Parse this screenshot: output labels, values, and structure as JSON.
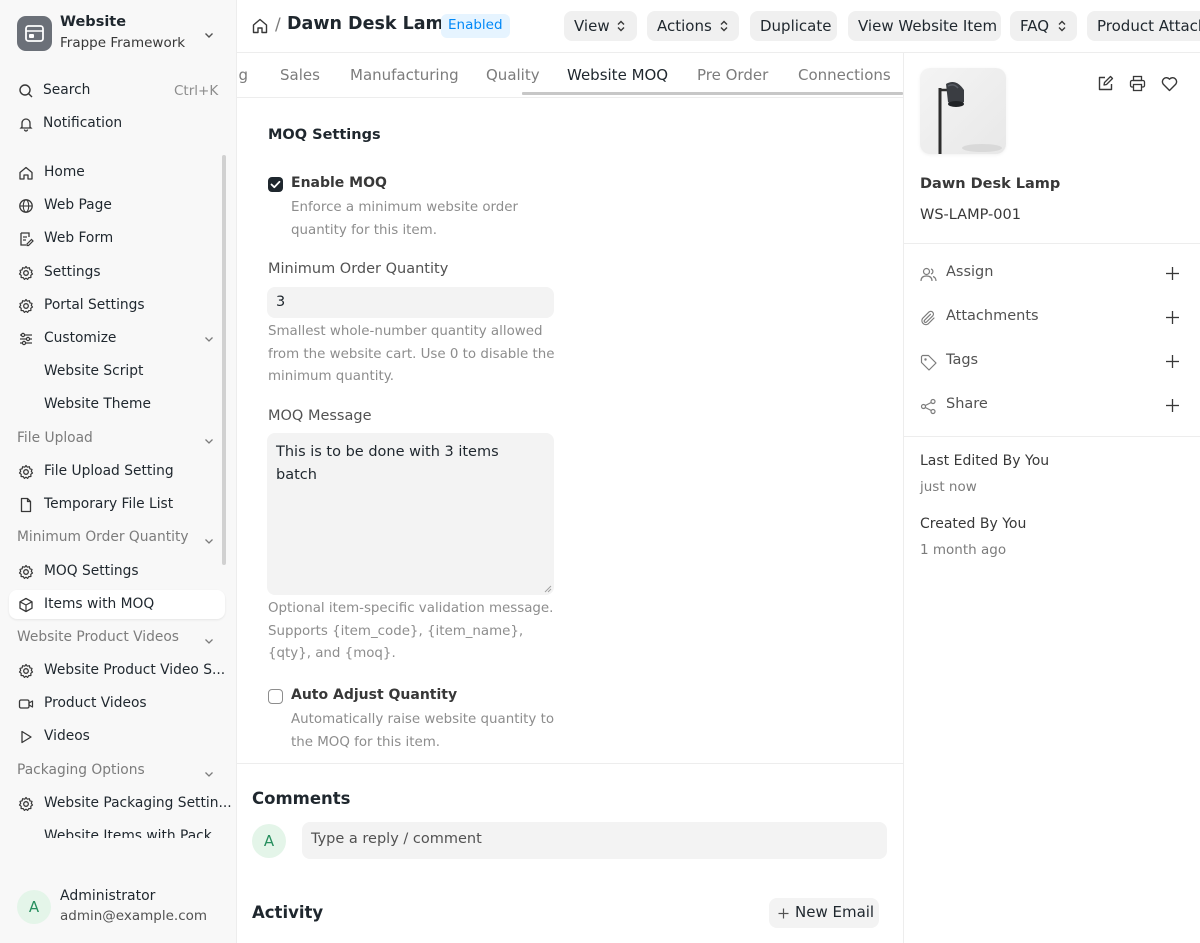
{
  "app": {
    "name": "Website",
    "subtitle": "Frappe Framework"
  },
  "sidebar": {
    "search_label": "Search",
    "search_shortcut": "Ctrl+K",
    "notification_label": "Notification",
    "items": [
      {
        "label": "Home",
        "icon": "home-icon"
      },
      {
        "label": "Web Page",
        "icon": "globe-icon"
      },
      {
        "label": "Web Form",
        "icon": "form-icon"
      },
      {
        "label": "Settings",
        "icon": "gear-icon"
      },
      {
        "label": "Portal Settings",
        "icon": "gear-icon"
      },
      {
        "label": "Customize",
        "icon": "sliders-icon"
      },
      {
        "label": "Website Script"
      },
      {
        "label": "Website Theme"
      }
    ],
    "section_file_upload": "File Upload",
    "file_upload_items": [
      {
        "label": "File Upload Setting",
        "icon": "gear-icon"
      },
      {
        "label": "Temporary File List",
        "icon": "file-icon"
      }
    ],
    "section_moq": "Minimum Order Quantity",
    "moq_items": [
      {
        "label": "MOQ Settings",
        "icon": "gear-icon"
      },
      {
        "label": "Items with MOQ",
        "icon": "box-icon"
      }
    ],
    "section_videos": "Website Product Videos",
    "video_items": [
      {
        "label": "Website Product Video S...",
        "icon": "gear-icon"
      },
      {
        "label": "Product Videos",
        "icon": "video-icon"
      },
      {
        "label": "Videos",
        "icon": "play-icon"
      }
    ],
    "section_packaging": "Packaging Options",
    "packaging_items": [
      {
        "label": "Website Packaging Settin...",
        "icon": "gear-icon"
      },
      {
        "label": "Website Items with Pack..."
      }
    ],
    "user": {
      "initial": "A",
      "name": "Administrator",
      "email": "admin@example.com"
    }
  },
  "header": {
    "breadcrumb_sep": "/",
    "title": "Dawn Desk Lamp",
    "status": "Enabled",
    "buttons": {
      "view": "View",
      "actions": "Actions",
      "duplicate": "Duplicate",
      "view_website_item": "View Website Item",
      "faq": "FAQ",
      "product_attach": "Product Attach"
    }
  },
  "tabs": [
    "g",
    "Sales",
    "Manufacturing",
    "Quality",
    "Website MOQ",
    "Pre Order",
    "Connections"
  ],
  "form": {
    "section_title": "MOQ Settings",
    "enable_moq": {
      "label": "Enable MOQ",
      "checked": true,
      "description": "Enforce a minimum website order quantity for this item."
    },
    "min_qty": {
      "label": "Minimum Order Quantity",
      "value": "3",
      "description": "Smallest whole-number quantity allowed from the website cart. Use 0 to disable the minimum quantity."
    },
    "moq_message": {
      "label": "MOQ Message",
      "value": "This is to be done with 3 items batch",
      "description": "Optional item-specific validation message. Supports {item_code}, {item_name}, {qty}, and {moq}."
    },
    "auto_adjust": {
      "label": "Auto Adjust Quantity",
      "checked": false,
      "description": "Automatically raise website quantity to the MOQ for this item."
    }
  },
  "comments": {
    "title": "Comments",
    "avatar": "A",
    "placeholder": "Type a reply / comment"
  },
  "activity": {
    "title": "Activity",
    "new_email": "New Email"
  },
  "right_panel": {
    "item_name": "Dawn Desk Lamp",
    "item_code": "WS-LAMP-001",
    "assign": "Assign",
    "attachments": "Attachments",
    "tags": "Tags",
    "share": "Share",
    "last_edited_label": "Last Edited By You",
    "last_edited_time": "just now",
    "created_label": "Created By You",
    "created_time": "1 month ago"
  },
  "colors": {
    "accent": "#0289f7",
    "badge_bg": "#e6f4ff",
    "sidebar_bg": "#f8f8f8"
  }
}
